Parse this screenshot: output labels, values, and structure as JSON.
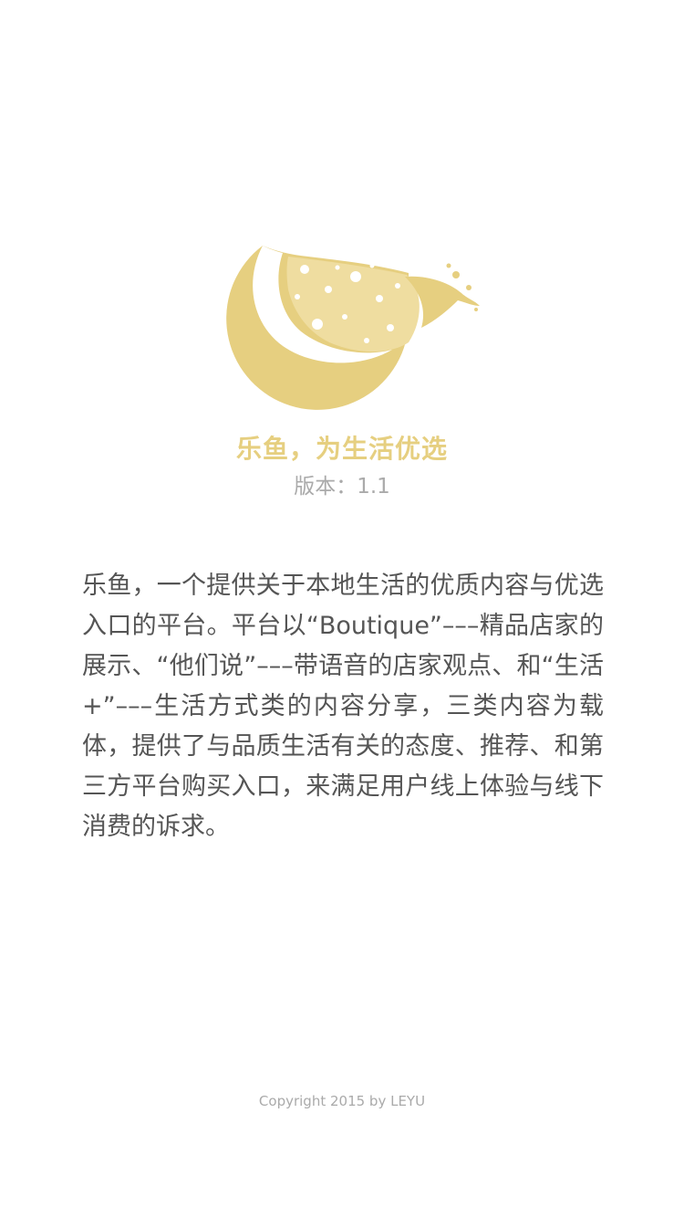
{
  "brand": {
    "tagline": "乐鱼，为生活优选",
    "version": "版本：1.1",
    "logo_icon": "leyu-logo-icon"
  },
  "about": {
    "description": "乐鱼，一个提供关于本地生活的优质内容与优选入口的平台。平台以“Boutique”–––精品店家的展示、“他们说”–––带语音的店家观点、和“生活+”–––生活方式类的内容分享，三类内容为载体，提供了与品质生活有关的态度、推荐、和第三方平台购买入口，来满足用户线上体验与线下消费的诉求。"
  },
  "footer": {
    "copyright": "Copyright 2015 by LEYU"
  },
  "colors": {
    "brand_gold": "#E6CF80",
    "brand_gold_light": "#EFDDA0",
    "text_main": "#555555",
    "text_muted": "#AAAAAA",
    "background": "#FFFFFF"
  }
}
